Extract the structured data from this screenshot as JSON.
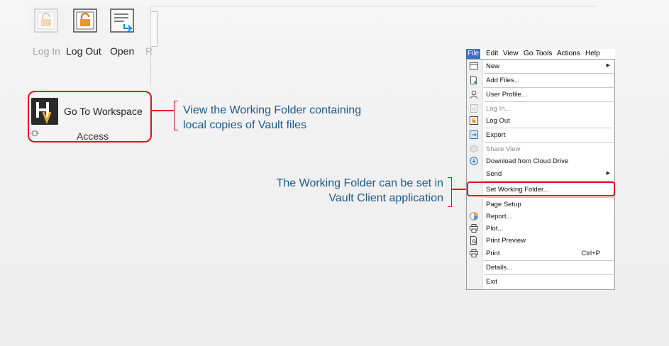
{
  "ribbon": {
    "login_label": "Log In",
    "logout_label": "Log Out",
    "open_label": "Open",
    "cut_label": "R",
    "workspace_label": "Go To Workspace",
    "group_label": "Access"
  },
  "callouts": {
    "workspace_line1": "View the Working Folder containing",
    "workspace_line2": "local copies of Vault files",
    "vault_line1": "The Working Folder can be set in",
    "vault_line2": "Vault Client application"
  },
  "menubar": {
    "file": "File",
    "edit": "Edit",
    "view": "View",
    "go": "Go",
    "tools": "Tools",
    "actions": "Actions",
    "help": "Help"
  },
  "menu": {
    "new": "New",
    "add_files": "Add Files...",
    "user_profile": "User Profile...",
    "log_in": "Log In...",
    "log_out": "Log Out",
    "export": "Export",
    "share_view": "Share View",
    "download_cloud": "Download from Cloud Drive",
    "send": "Send",
    "set_working_folder": "Set Working Folder...",
    "page_setup": "Page Setup",
    "report": "Report...",
    "plot": "Plot...",
    "print_preview": "Print Preview",
    "print": "Print",
    "print_shortcut": "Ctrl+P",
    "details": "Details...",
    "exit": "Exit"
  },
  "colors": {
    "highlight": "#e3101c",
    "callout_text": "#1d5a8c",
    "menu_active": "#3a6fc4"
  }
}
